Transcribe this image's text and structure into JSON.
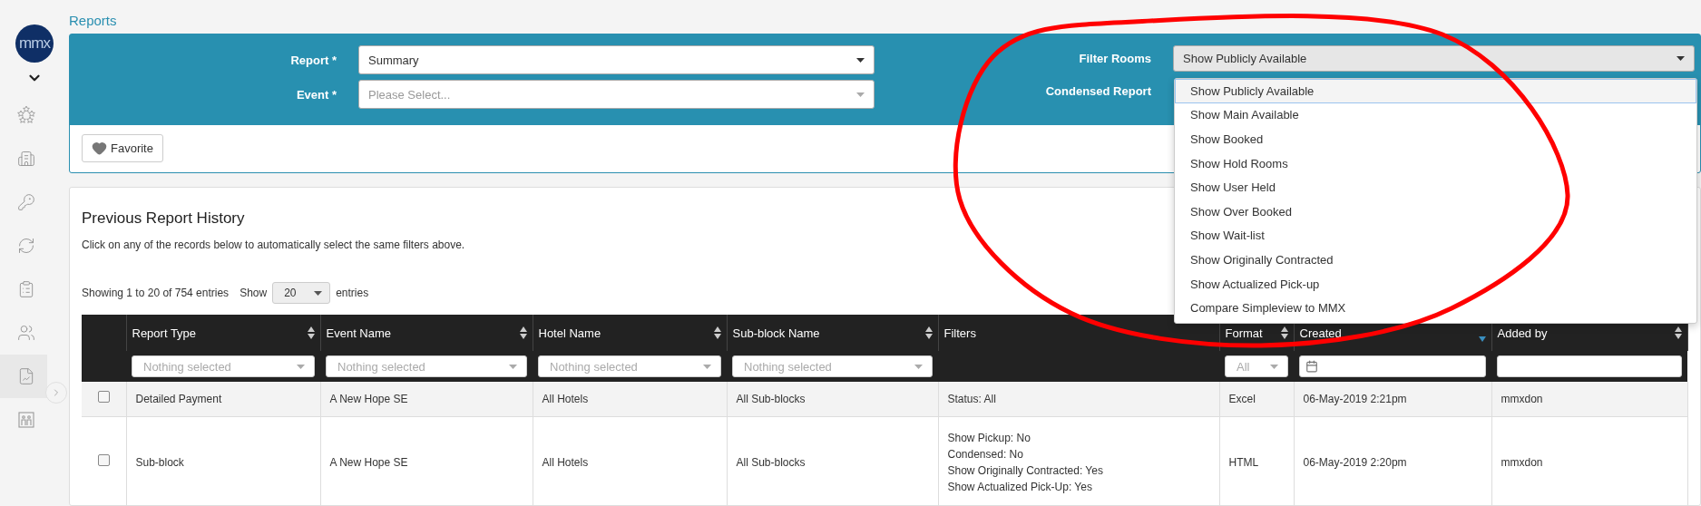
{
  "logo": {
    "text": "mmx"
  },
  "sidebar": {
    "items": [
      {
        "selected": false
      },
      {
        "selected": false
      },
      {
        "selected": false
      },
      {
        "selected": false
      },
      {
        "selected": false
      },
      {
        "selected": false
      },
      {
        "selected": true
      },
      {
        "selected": false
      }
    ]
  },
  "breadcrumb": "Reports",
  "form": {
    "left": [
      {
        "label": "Report *",
        "value": "Summary"
      },
      {
        "label": "Event *",
        "placeholder": "Please Select..."
      }
    ],
    "filter_rooms": {
      "label": "Filter Rooms",
      "value": "Show Publicly Available",
      "expanded": true,
      "options": [
        {
          "label": "Show Publicly Available",
          "selected": true
        },
        {
          "label": "Show Main Available",
          "selected": false
        },
        {
          "label": "Show Booked",
          "selected": false
        },
        {
          "label": "Show Hold Rooms",
          "selected": false
        },
        {
          "label": "Show User Held",
          "selected": false
        },
        {
          "label": "Show Over Booked",
          "selected": false
        },
        {
          "label": "Show Wait-list",
          "selected": false
        },
        {
          "label": "Show Originally Contracted",
          "selected": false
        },
        {
          "label": "Show Actualized Pick-up",
          "selected": false
        },
        {
          "label": "Compare Simpleview to MMX",
          "selected": false
        }
      ]
    },
    "condensed_report": {
      "label": "Condensed Report"
    },
    "favorite_button": "Favorite"
  },
  "history": {
    "title": "Previous Report History",
    "description": "Click on any of the records below to automatically select the same filters above.",
    "showing": "Showing 1 to 20 of 754 entries",
    "show_label": "Show",
    "page_size": "20",
    "entries_label": "entries",
    "columns": [
      {
        "label": "Report Type",
        "sortable": true,
        "sorted": false,
        "filter": {
          "kind": "select",
          "placeholder": "Nothing selected"
        }
      },
      {
        "label": "Event Name",
        "sortable": true,
        "sorted": false,
        "filter": {
          "kind": "select",
          "placeholder": "Nothing selected"
        }
      },
      {
        "label": "Hotel Name",
        "sortable": true,
        "sorted": false,
        "filter": {
          "kind": "select",
          "placeholder": "Nothing selected"
        }
      },
      {
        "label": "Sub-block Name",
        "sortable": true,
        "sorted": false,
        "filter": {
          "kind": "select",
          "placeholder": "Nothing selected"
        }
      },
      {
        "label": "Filters",
        "sortable": false,
        "sorted": false
      },
      {
        "label": "Format",
        "sortable": true,
        "sorted": false,
        "filter": {
          "kind": "select",
          "placeholder": "All"
        }
      },
      {
        "label": "Created",
        "sortable": true,
        "sorted": true,
        "filter": {
          "kind": "date"
        }
      },
      {
        "label": "Added by",
        "sortable": true,
        "sorted": false,
        "filter": {
          "kind": "text"
        }
      }
    ],
    "rows": [
      {
        "checked": false,
        "highlighted": true,
        "cells": [
          "Detailed Payment",
          "A New Hope SE",
          "All Hotels",
          "All Sub-blocks",
          [
            "Status: All"
          ],
          "Excel",
          "06-May-2019 2:21pm",
          "mmxdon"
        ]
      },
      {
        "checked": false,
        "highlighted": false,
        "cells": [
          "Sub-block",
          "A New Hope SE",
          "All Hotels",
          "All Sub-blocks",
          [
            "Show Pickup: No",
            "Condensed: No",
            "Show Originally Contracted: Yes",
            "Show Actualized Pick-Up: Yes"
          ],
          "HTML",
          "06-May-2019 2:20pm",
          "mmxdon"
        ]
      }
    ]
  },
  "annotation": {
    "kind": "ellipse",
    "color": "#ff0000"
  }
}
